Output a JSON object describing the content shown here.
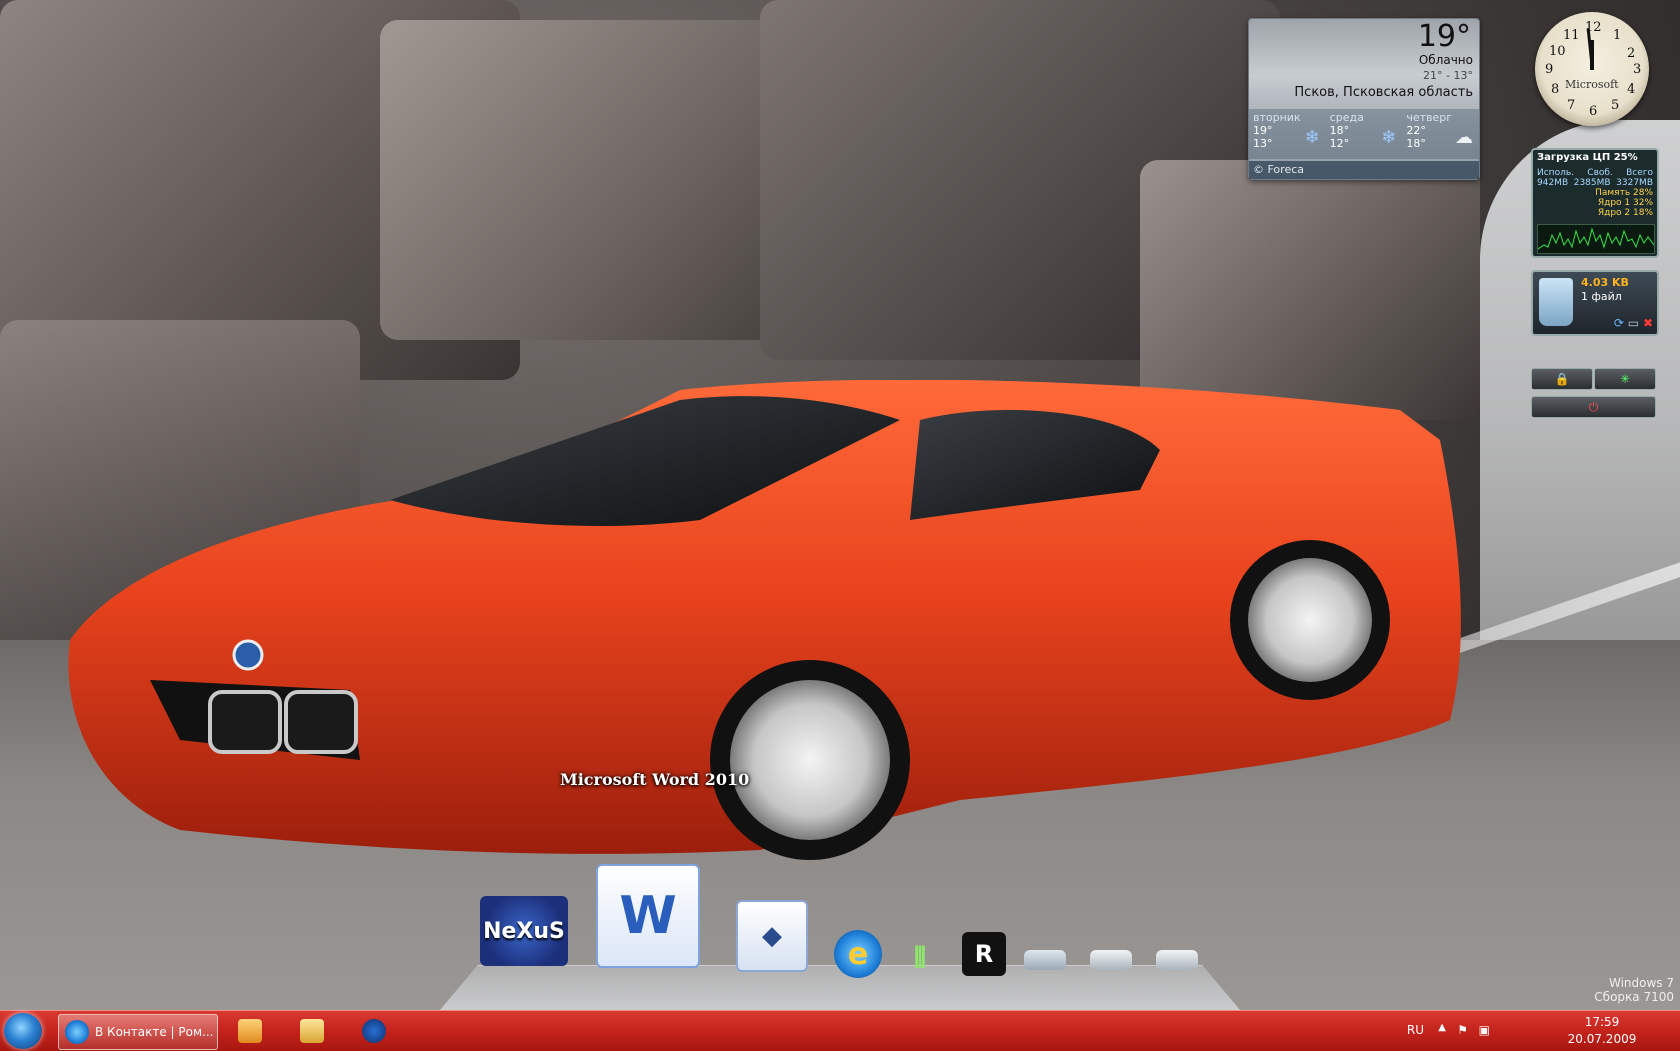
{
  "weather": {
    "temperature": "19°",
    "condition": "Облачно",
    "range": "21° - 13°",
    "city": "Псков, Псковская область",
    "forecast": [
      {
        "day": "вторник",
        "high": "19°",
        "low": "13°"
      },
      {
        "day": "среда",
        "high": "18°",
        "low": "12°"
      },
      {
        "day": "четверг",
        "high": "22°",
        "low": "18°"
      }
    ],
    "footer": "© Foreca"
  },
  "clock": {
    "brand": "Microsoft",
    "numbers": [
      "12",
      "1",
      "2",
      "3",
      "4",
      "5",
      "6",
      "7",
      "8",
      "9",
      "10",
      "11"
    ]
  },
  "cpu": {
    "title": "Загрузка ЦП  25%",
    "headers": [
      "Исполь.",
      "Своб.",
      "Всего"
    ],
    "values": [
      "942MB",
      "2385MB",
      "3327MB"
    ],
    "memory": "Память  28%",
    "core1": "Ядро 1   32%",
    "core2": "Ядро 2   18%"
  },
  "recycle": {
    "size": "4.03 KB",
    "count": "1 файл"
  },
  "dock": {
    "active_label": "Microsoft Word 2010",
    "nexus_label": "NeXuS",
    "word_letter": "W",
    "rockstar_letter": "R"
  },
  "watermark": {
    "line1": "Windows 7",
    "line2": "Сборка 7100"
  },
  "taskbar": {
    "ie_title": "В Контакте | Ром...",
    "lang": "RU",
    "time": "17:59",
    "date": "20.07.2009"
  }
}
